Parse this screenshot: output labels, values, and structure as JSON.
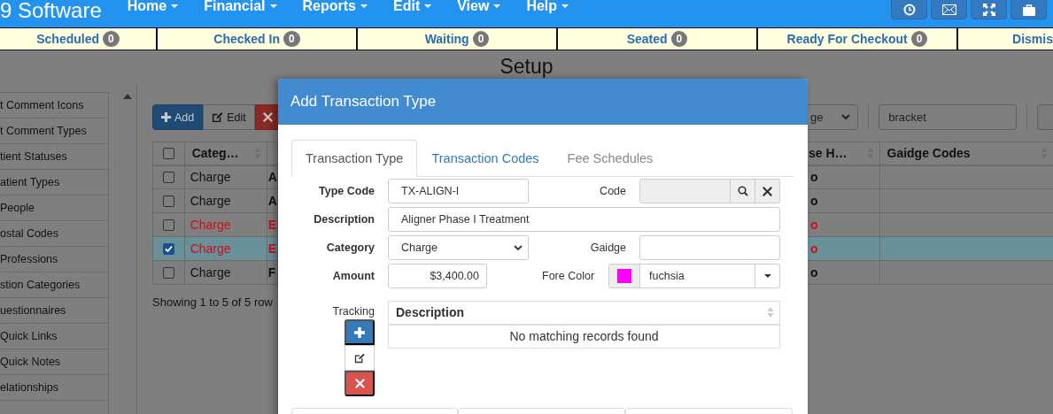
{
  "navbar": {
    "brand": "9 Software",
    "menus": [
      {
        "label": "Home"
      },
      {
        "label": "Financial"
      },
      {
        "label": "Reports"
      },
      {
        "label": "Edit"
      },
      {
        "label": "View"
      },
      {
        "label": "Help"
      }
    ],
    "tools": [
      {
        "kind": "clock"
      },
      {
        "kind": "mail"
      },
      {
        "kind": "expand"
      },
      {
        "kind": "briefcase"
      }
    ]
  },
  "status_bar": [
    {
      "label": "Scheduled",
      "count": "0"
    },
    {
      "label": "Checked In",
      "count": "0"
    },
    {
      "label": "Waiting",
      "count": "0"
    },
    {
      "label": "Seated",
      "count": "0"
    },
    {
      "label": "Ready For Checkout",
      "count": "0"
    },
    {
      "label": "Dismis"
    }
  ],
  "page": {
    "title": "Setup"
  },
  "sidebar": {
    "items": [
      "t Comment Icons",
      "t Comment Types",
      "tient Statuses",
      "atient Types",
      "People",
      "ostal Codes",
      "Professions",
      "stion Categories",
      "uestionnaires",
      "Quick Links",
      "Quick Notes",
      "elationships"
    ]
  },
  "toolbar": {
    "buttons": [
      {
        "kind": "add",
        "label": "Add"
      },
      {
        "kind": "edit",
        "label": "Edit"
      },
      {
        "kind": "delete"
      }
    ],
    "filter": "ge",
    "search": "bracket"
  },
  "table": {
    "all_checked": false,
    "columns": [
      "Categ…",
      "se H…",
      "Gaidge Codes"
    ],
    "rows": [
      {
        "checked": false,
        "selected": false,
        "color": "#111111",
        "category": "Charge",
        "column_3": "A",
        "column_5": "o"
      },
      {
        "checked": false,
        "selected": false,
        "color": "#111111",
        "category": "Charge",
        "column_3": "A",
        "column_5": "o"
      },
      {
        "checked": false,
        "selected": false,
        "color": "#c8101e",
        "category": "Charge",
        "column_3": "E",
        "column_5": "o"
      },
      {
        "checked": true,
        "selected": true,
        "color": "#c8101e",
        "category": "Charge",
        "column_3": "E",
        "column_5": "o"
      },
      {
        "checked": false,
        "selected": false,
        "color": "#111111",
        "category": "Charge",
        "column_3": "F",
        "column_5": "o"
      }
    ],
    "summary": "Showing 1 to 5 of 5 row"
  },
  "modal": {
    "title": "Add Transaction Type",
    "tabs": [
      {
        "label": "Transaction Type",
        "selected": true,
        "disabled": false
      },
      {
        "label": "Transaction Codes",
        "selected": false,
        "disabled": false
      },
      {
        "label": "Fee Schedules",
        "selected": false,
        "disabled": true
      }
    ],
    "form": {
      "type_code": {
        "label": "Type Code",
        "value": "TX-ALIGN-I"
      },
      "code": {
        "label": "Code",
        "disabled": true
      },
      "description": {
        "label": "Description",
        "value": "Aligner Phase I Treatment"
      },
      "category": {
        "label": "Category",
        "value": "Charge"
      },
      "gaidge": {
        "label": "Gaidge"
      },
      "amount": {
        "label": "Amount",
        "value": "$3,400.00"
      },
      "fore_color": {
        "label": "Fore Color",
        "value": "fuchsia",
        "color": "#ff00ff"
      }
    },
    "tracking": {
      "label": "Tracking",
      "columns": [
        "Description"
      ],
      "empty_text": "No matching records found"
    }
  }
}
